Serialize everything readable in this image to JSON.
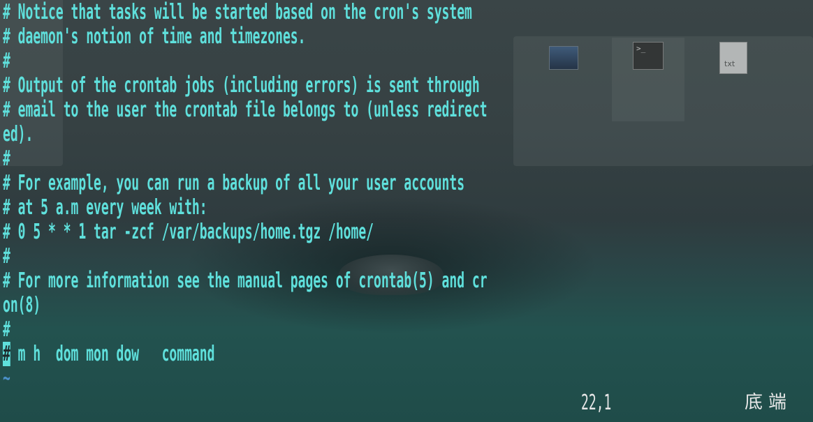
{
  "desktop": {
    "txt_icon_label": "txt"
  },
  "editor": {
    "lines": [
      "# Notice that tasks will be started based on the cron's system",
      "# daemon's notion of time and timezones.",
      "#",
      "# Output of the crontab jobs (including errors) is sent through",
      "# email to the user the crontab file belongs to (unless redirect",
      "ed).",
      "#",
      "# For example, you can run a backup of all your user accounts",
      "# at 5 a.m every week with:",
      "# 0 5 * * 1 tar -zcf /var/backups/home.tgz /home/",
      "#",
      "# For more information see the manual pages of crontab(5) and cr",
      "on(8)",
      "#"
    ],
    "cursor_char": "#",
    "last_line_rest": " m h  dom mon dow   command",
    "tilde": "~"
  },
  "status": {
    "position": "22,1",
    "where": "底端"
  },
  "colors": {
    "text": "#5fe0dc",
    "tilde": "#4a90c8",
    "status": "#e8e8e8"
  }
}
